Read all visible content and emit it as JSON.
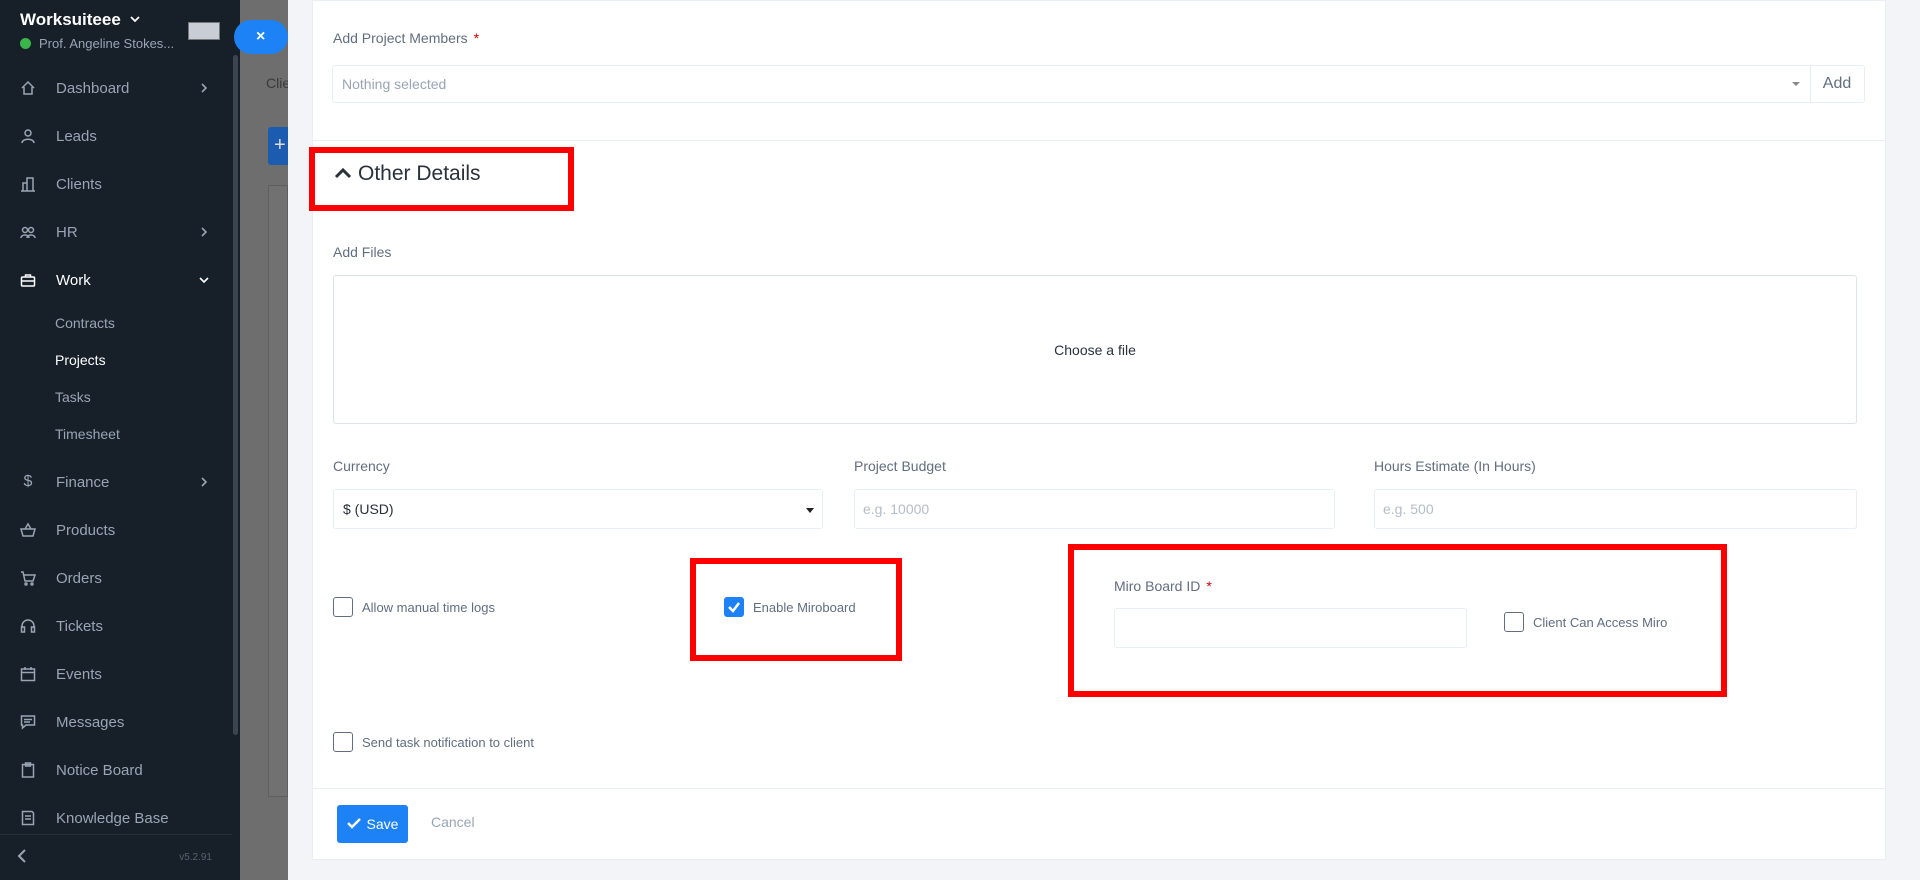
{
  "sidebar": {
    "workspace_name": "Worksuiteee",
    "user_name": "Prof. Angeline Stokes...",
    "status_color": "#39b54a",
    "close_label": "×",
    "items": [
      {
        "label": "Dashboard",
        "icon": "home-icon"
      },
      {
        "label": "Leads",
        "icon": "user-icon"
      },
      {
        "label": "Clients",
        "icon": "building-icon"
      },
      {
        "label": "HR",
        "icon": "users-icon"
      },
      {
        "label": "Work",
        "icon": "briefcase-icon"
      },
      {
        "label": "Finance",
        "icon": "dollar-icon"
      },
      {
        "label": "Products",
        "icon": "basket-icon"
      },
      {
        "label": "Orders",
        "icon": "cart-icon"
      },
      {
        "label": "Tickets",
        "icon": "headset-icon"
      },
      {
        "label": "Events",
        "icon": "calendar-icon"
      },
      {
        "label": "Messages",
        "icon": "message-icon"
      },
      {
        "label": "Notice Board",
        "icon": "clipboard-icon"
      },
      {
        "label": "Knowledge Base",
        "icon": "book-icon"
      }
    ],
    "work_sub_items": [
      "Contracts",
      "Projects",
      "Tasks",
      "Timesheet"
    ],
    "version": "v5.2.91"
  },
  "background_page": {
    "tab_fragment": "Clie",
    "add_button": "+"
  },
  "form": {
    "members_label": "Add Project Members",
    "required_mark": "*",
    "members_placeholder": "Nothing selected",
    "members_add": "Add",
    "section_title": "Other Details",
    "add_files_label": "Add Files",
    "dropzone_text": "Choose a file",
    "currency_label": "Currency",
    "currency_value": "$ (USD)",
    "budget_label": "Project Budget",
    "budget_placeholder": "e.g. 10000",
    "hours_label": "Hours Estimate (In Hours)",
    "hours_placeholder": "e.g. 500",
    "allow_manual_label": "Allow manual time logs",
    "allow_manual_checked": false,
    "enable_miro_label": "Enable Miroboard",
    "enable_miro_checked": true,
    "miro_id_label": "Miro Board ID",
    "miro_id_value": "",
    "client_miro_label": "Client Can Access Miro",
    "client_miro_checked": false,
    "send_notification_label": "Send task notification to client",
    "send_notification_checked": false,
    "save_label": "Save",
    "cancel_label": "Cancel"
  },
  "colors": {
    "accent": "#1d82f5",
    "highlight": "#ff0000",
    "sidebar_bg": "#171f29"
  }
}
